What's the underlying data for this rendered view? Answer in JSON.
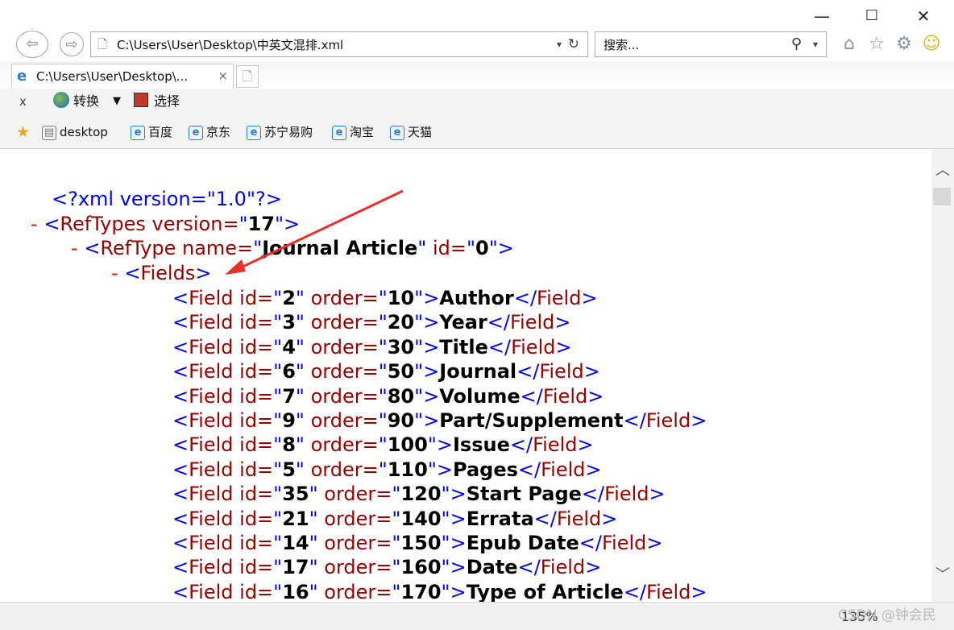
{
  "window": {
    "minimize": "—",
    "maximize": "☐",
    "close": "✕"
  },
  "address": {
    "url": "C:\\Users\\User\\Desktop\\中英文混排.xml",
    "dropdown": "▾",
    "refresh": "↻"
  },
  "search": {
    "placeholder": "搜索...",
    "icon": "⚲",
    "dropdown": "▾"
  },
  "toolbar_icons": {
    "home": "⌂",
    "favorites": "☆",
    "settings": "⚙",
    "smiley": "☺"
  },
  "tab": {
    "title": "C:\\Users\\User\\Desktop\\...",
    "close": "×"
  },
  "command_bar": {
    "close": "x",
    "convert_label": "转换",
    "arrow": "▼",
    "select_label": "选择"
  },
  "favorites": [
    {
      "label": "desktop"
    },
    {
      "label": "百度"
    },
    {
      "label": "京东"
    },
    {
      "label": "苏宁易购"
    },
    {
      "label": "淘宝"
    },
    {
      "label": "天猫"
    }
  ],
  "xml": {
    "decl": "<?xml version=\"1.0\"?>",
    "reftypes": {
      "minus": "-",
      "open": "<",
      "tag": "RefTypes",
      "attr": " version=",
      "q1": "\"",
      "val": "17",
      "q2": "\"",
      "close": ">"
    },
    "reftype": {
      "minus": "-",
      "open": "<",
      "tag": "RefType",
      "attr1": " name=",
      "q1": "\"",
      "val1": "Journal Article",
      "q2": "\"",
      "attr2": " id=",
      "q3": "\"",
      "val2": "0",
      "q4": "\"",
      "close": ">"
    },
    "fields": {
      "minus": "-",
      "open": "<",
      "tag": "Fields",
      "close": ">"
    },
    "field_rows": [
      {
        "id": "2",
        "order": "10",
        "text": "Author"
      },
      {
        "id": "3",
        "order": "20",
        "text": "Year"
      },
      {
        "id": "4",
        "order": "30",
        "text": "Title"
      },
      {
        "id": "6",
        "order": "50",
        "text": "Journal"
      },
      {
        "id": "7",
        "order": "80",
        "text": "Volume"
      },
      {
        "id": "9",
        "order": "90",
        "text": "Part/Supplement"
      },
      {
        "id": "8",
        "order": "100",
        "text": "Issue"
      },
      {
        "id": "5",
        "order": "110",
        "text": "Pages"
      },
      {
        "id": "35",
        "order": "120",
        "text": "Start Page"
      },
      {
        "id": "21",
        "order": "140",
        "text": "Errata"
      },
      {
        "id": "14",
        "order": "150",
        "text": "Epub Date"
      },
      {
        "id": "17",
        "order": "160",
        "text": "Date"
      },
      {
        "id": "16",
        "order": "170",
        "text": "Type of Article"
      }
    ]
  },
  "scroll": {
    "up": "︿",
    "down": "﹀"
  },
  "status": {
    "zoom": "135%",
    "watermark": "CSDN @钟会民"
  },
  "annotation": {
    "arrow_color": "#e8302b"
  }
}
